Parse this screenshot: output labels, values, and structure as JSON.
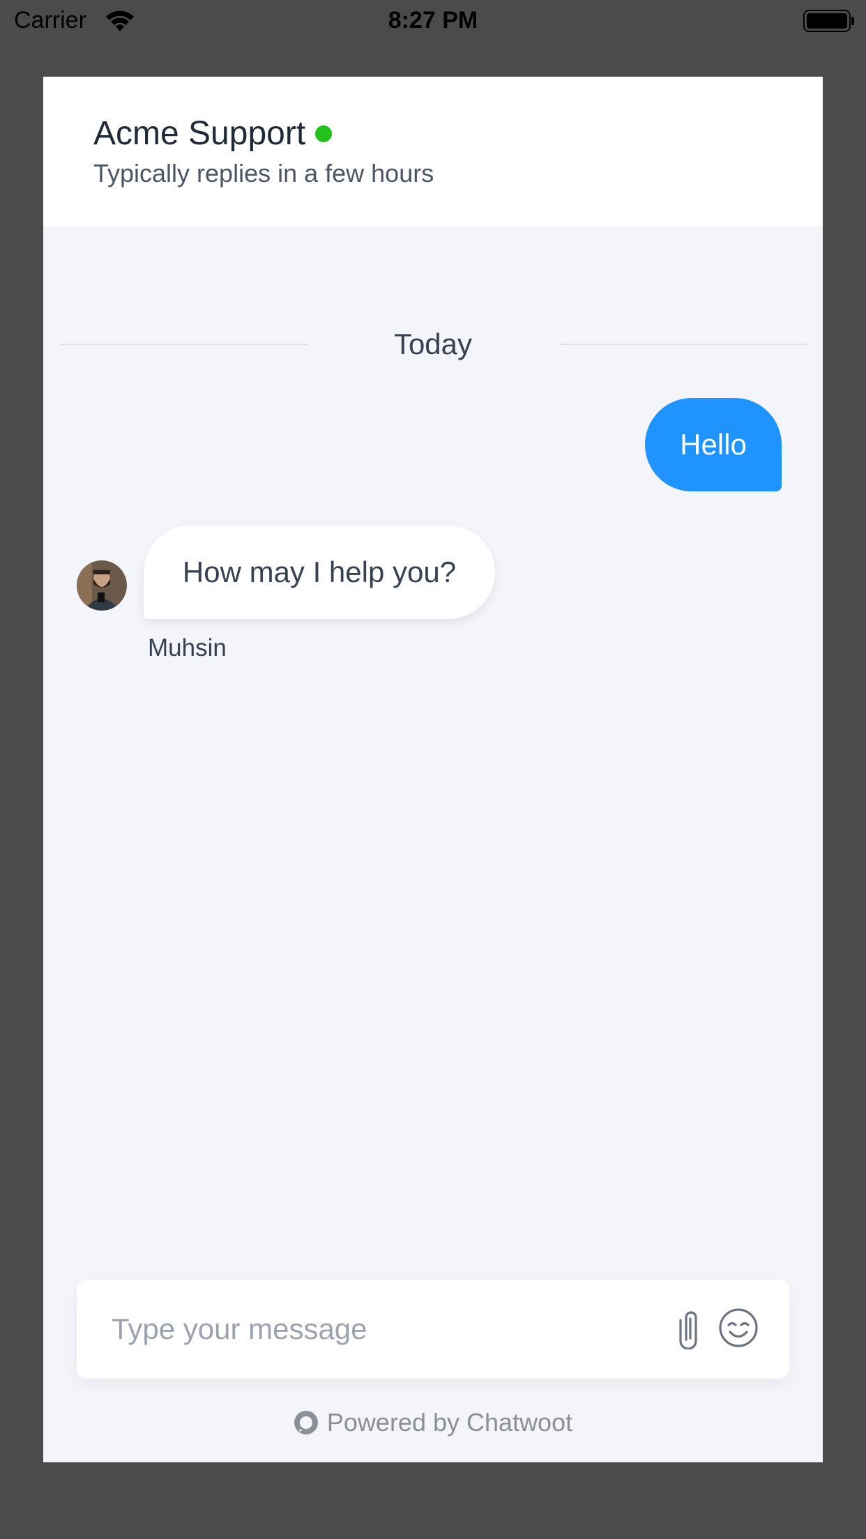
{
  "status_bar": {
    "carrier": "Carrier",
    "time": "8:27 PM",
    "icons": [
      "wifi-icon",
      "battery-icon"
    ]
  },
  "header": {
    "title": "Acme Support",
    "subtitle": "Typically replies in a few hours",
    "online": true,
    "online_color": "#22c11c"
  },
  "conversation": {
    "date_label": "Today",
    "messages": [
      {
        "direction": "outgoing",
        "text": "Hello"
      },
      {
        "direction": "incoming",
        "text": "How may I help you?",
        "sender": "Muhsin"
      }
    ]
  },
  "composer": {
    "placeholder": "Type your message",
    "icons": [
      "attachment-icon",
      "emoji-icon"
    ]
  },
  "footer": {
    "powered_by": "Powered by Chatwoot"
  },
  "colors": {
    "outgoing_bubble": "#1f93ff",
    "background": "#f3f5fa",
    "page_dim": "#4b4b4b"
  }
}
